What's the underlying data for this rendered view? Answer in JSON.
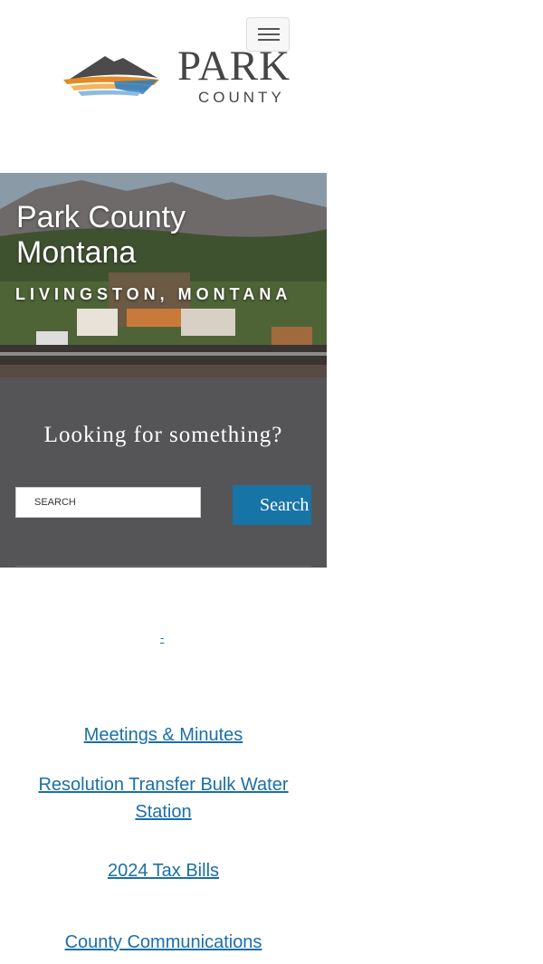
{
  "header": {
    "menu_button_label": "",
    "logo": {
      "word": "PARK",
      "sub": "COUNTY",
      "colors": {
        "mountain": "#4b4b4b",
        "orange": "#e28a25",
        "blue": "#2b7bbd"
      }
    }
  },
  "hero": {
    "title": "Park County Montana",
    "subtitle": "LIVINGSTON, MONTANA"
  },
  "search": {
    "heading": "Looking for something?",
    "placeholder": "SEARCH",
    "button_label": "Search"
  },
  "links": {
    "dash": "-",
    "items": [
      {
        "label": "Meetings & Minutes"
      },
      {
        "label": "Resolution Transfer Bulk Water Station"
      },
      {
        "label": "2024 Tax Bills"
      },
      {
        "label": "County Communications"
      }
    ]
  },
  "colors": {
    "accent": "#1774a6",
    "link": "#1a6fa8",
    "panel": "#555558"
  }
}
